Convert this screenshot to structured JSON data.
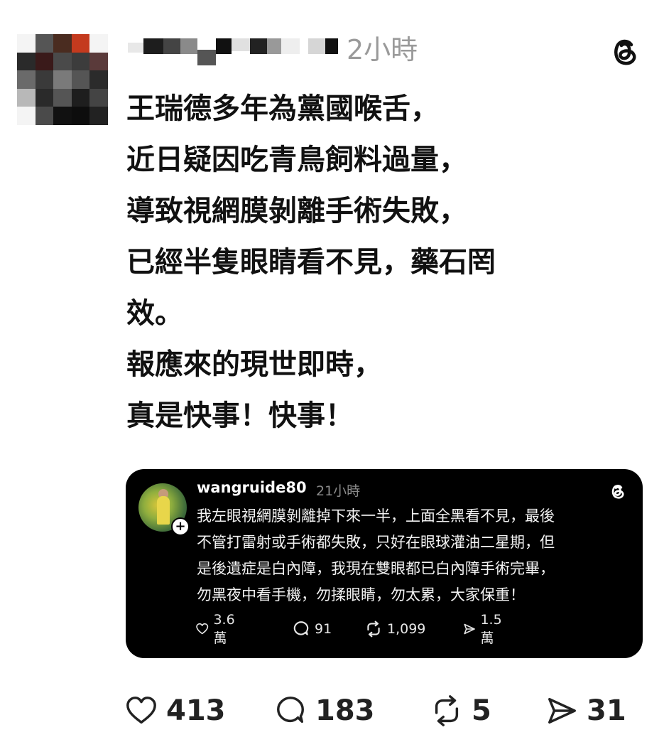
{
  "post": {
    "time": "2小時",
    "text_lines": [
      "王瑞德多年為黨國喉舌，",
      "近日疑因吃青鳥飼料過量，",
      "導致視網膜剝離手術失敗，",
      "已經半隻眼睛看不見，藥石罔",
      "效。",
      "報應來的現世即時，",
      "真是快事！快事！"
    ],
    "actions": {
      "likes": "413",
      "comments": "183",
      "reposts": "5",
      "shares": "31"
    }
  },
  "embedded_post": {
    "username": "wangruide80",
    "time": "21小時",
    "text_lines": [
      "我左眼視網膜剝離掉下來一半，上面全黑看不見，最後",
      "不管打雷射或手術都失敗，只好在眼球灌油二星期，但",
      "是後遺症是白內障，我現在雙眼都已白內障手術完畢，",
      "勿黑夜中看手機，勿揉眼睛，勿太累，大家保重！"
    ],
    "stats": {
      "likes": "3.6萬",
      "comments": "91",
      "reposts": "1,099",
      "shares": "1.5萬"
    }
  },
  "icons": {
    "logo": "threads-logo-icon",
    "like": "heart-icon",
    "comment": "comment-bubble-icon",
    "repost": "repost-icon",
    "share": "share-send-icon",
    "follow": "plus-icon"
  },
  "colors": {
    "background": "#ffffff",
    "text": "#111111",
    "muted": "#9a9a9a",
    "embed_background": "#000000"
  }
}
